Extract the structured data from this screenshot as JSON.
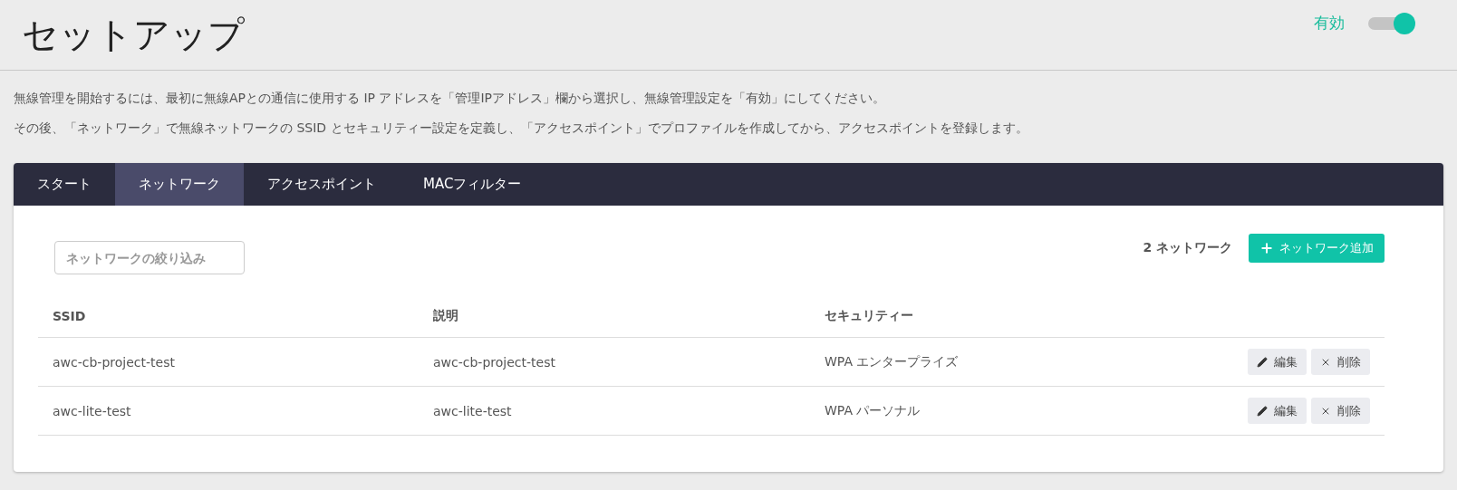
{
  "header": {
    "title": "セットアップ",
    "toggle": {
      "label": "有効",
      "on": true
    }
  },
  "intro": [
    "無線管理を開始するには、最初に無線APとの通信に使用する IP アドレスを「管理IPアドレス」欄から選択し、無線管理設定を「有効」にしてください。",
    "その後、「ネットワーク」で無線ネットワークの SSID とセキュリティー設定を定義し、「アクセスポイント」でプロファイルを作成してから、アクセスポイントを登録します。"
  ],
  "tabs": [
    {
      "label": "スタート",
      "selected": false
    },
    {
      "label": "ネットワーク",
      "selected": true
    },
    {
      "label": "アクセスポイント",
      "selected": false
    },
    {
      "label": "MACフィルター",
      "selected": false
    }
  ],
  "filter": {
    "placeholder": "ネットワークの絞り込み"
  },
  "count": "2 ネットワーク",
  "add_button": "ネットワーク追加",
  "table": {
    "columns": [
      "SSID",
      "説明",
      "セキュリティー"
    ],
    "rows": [
      {
        "cells": [
          "awc-cb-project-test",
          "awc-cb-project-test",
          "WPA エンタープライズ"
        ],
        "actions": [
          "編集",
          "削除"
        ]
      },
      {
        "cells": [
          "awc-lite-test",
          "awc-lite-test",
          "WPA パーソナル"
        ],
        "actions": [
          "編集",
          "削除"
        ]
      }
    ]
  }
}
